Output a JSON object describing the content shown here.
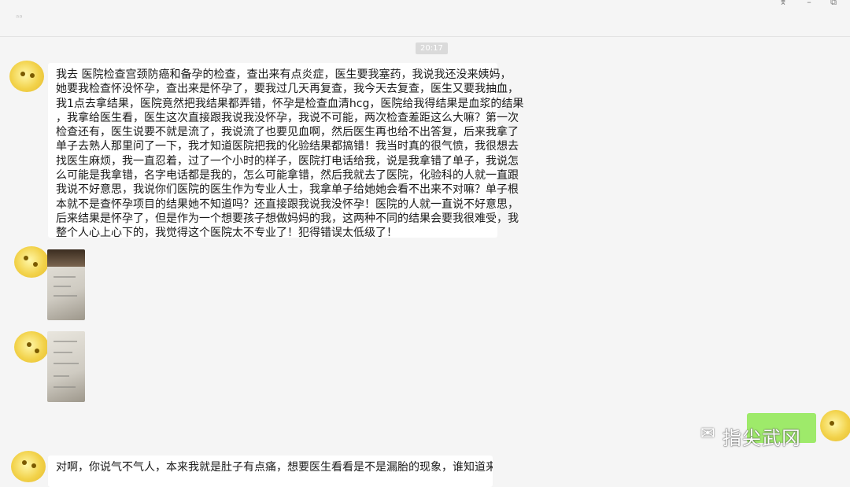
{
  "header": {
    "contact_name": "ᵃᵃ",
    "window_controls": [
      "⌆",
      "–",
      "⧉"
    ]
  },
  "chat": {
    "timestamp": "20:17",
    "messages": [
      {
        "lines": [
          "我去   医院检查宫颈防癌和备孕的检查，查出来有点炎症，医生要我塞药，我说我还没来姨妈，",
          "她要我检查怀没怀孕，查出来是怀孕了，要我过几天再复查，我今天去复查，医生又要我抽血，",
          "我1点去拿结果，医院竟然把我结果都弄错，怀孕是检查血清hcg，医院给我得结果是血浆的结果",
          "，我拿给医生看，医生这次直接跟我说我没怀孕，我说不可能，两次检查差距这么大嘛？第一次",
          "检查还有，医生说要不就是流了，我说流了也要见血啊，然后医生再也给不出答复，后来我拿了",
          "单子去熟人那里问了一下，我才知道医院把我的化验结果都搞错！我当时真的很气愤，我很想去",
          "找医生麻烦，我一直忍着，过了一个小时的样子，医院打电话给我，说是我拿错了单子，我说怎",
          "么可能是我拿错，名字电话都是我的，怎么可能拿错，然后我就去了医院，化验科的人就一直跟",
          "我说不好意思，我说你们医院的医生作为专业人士，我拿单子给她她会看不出来不对嘛？单子根",
          "本就不是查怀孕项目的结果她不知道吗？还直接跟我说我没怀孕！医院的人就一直说不好意思，",
          "后来结果是怀孕了，但是作为一个想要孩子想做妈妈的我，这两种不同的结果会要我很难受，我",
          "整个人心上心下的，我觉得这个医院太不专业了！犯得错误太低级了！"
        ]
      },
      {
        "lines": [
          "对啊，你说气不气人，本来我就是肚子有点痛，想要医生看看是不是漏胎的现象，谁知道来这一"
        ]
      }
    ]
  },
  "watermark": {
    "icon": "✉",
    "text": "指尖武冈"
  }
}
